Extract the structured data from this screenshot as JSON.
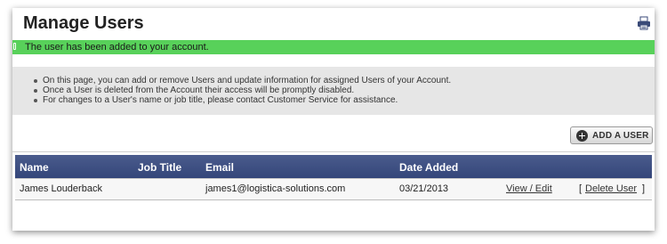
{
  "page": {
    "title": "Manage Users",
    "print_icon": "printer-icon"
  },
  "alert": {
    "message": "The user has been added to your account.",
    "color": "#58d15a"
  },
  "info": {
    "items": [
      "On this page, you can add or remove Users and update information for assigned Users of your Account.",
      "Once a User is deleted from the Account their access will be promptly disabled.",
      "For changes to a User's name or job title, please contact Customer Service for assistance."
    ]
  },
  "toolbar": {
    "add_user_label": "ADD A USER",
    "add_icon": "plus-circle-icon"
  },
  "table": {
    "headers": {
      "name": "Name",
      "job_title": "Job Title",
      "email": "Email",
      "date_added": "Date Added"
    },
    "header_color": "#3d4f83",
    "rows": [
      {
        "name": "James Louderback",
        "job_title": "",
        "email": "james1@logistica-solutions.com",
        "date_added": "03/21/2013",
        "view_edit": "View / Edit",
        "delete_open": "[",
        "delete": "Delete User",
        "delete_close": "]"
      }
    ]
  }
}
